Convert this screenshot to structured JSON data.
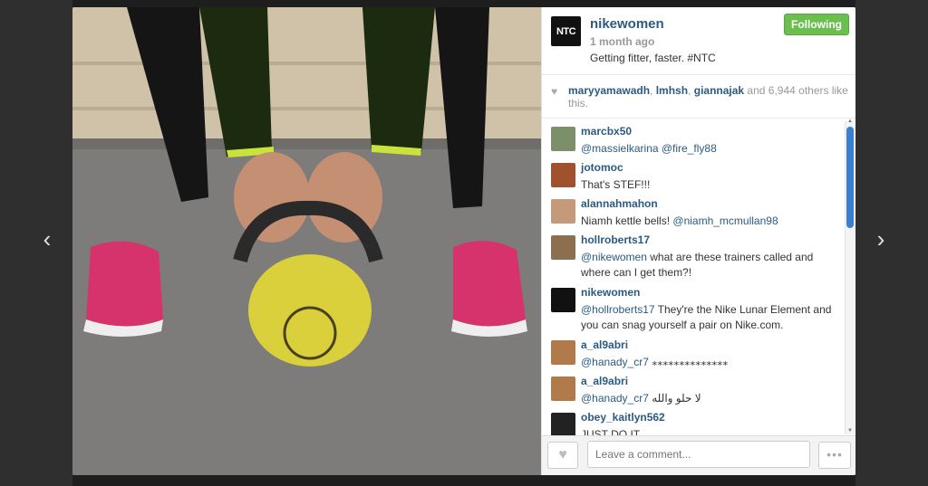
{
  "nav": {
    "prev_icon": "chevron-left-icon",
    "next_icon": "chevron-right-icon",
    "prev_glyph": "‹",
    "next_glyph": "›"
  },
  "post": {
    "avatar_text": "NTC",
    "username": "nikewomen",
    "time": "1 month ago",
    "caption": "Getting fitter, faster. #NTC",
    "follow_label": "Following",
    "likes": {
      "users": [
        "maryyamawadh",
        "lmhsh",
        "giannajak"
      ],
      "sep1": ", ",
      "sep2": ", ",
      "tail": " and 6,944 others like this."
    }
  },
  "comments": [
    {
      "user": "marcbx50",
      "mention": "@massielkarina @fire_fly88",
      "text": "",
      "avatar_color": "#7a8f6a"
    },
    {
      "user": "jotomoc",
      "mention": "",
      "text": "That's STEF!!!",
      "avatar_color": "#a0522d"
    },
    {
      "user": "alannahmahon",
      "mention": "",
      "text": "Niamh kettle bells!",
      "mention_after": "@niamh_mcmullan98",
      "avatar_color": "#c49a7a"
    },
    {
      "user": "hollroberts17",
      "mention": "@nikewomen",
      "text": " what are these trainers called and where can I get them?!",
      "avatar_color": "#8b6f4e"
    },
    {
      "user": "nikewomen",
      "mention": "@hollroberts17",
      "text": " They're the Nike Lunar Element and you can snag yourself a pair on Nike.com.",
      "avatar_color": "#111111"
    },
    {
      "user": "a_al9abri",
      "mention": "@hanady_cr7",
      "text": " ⁎⁎⁎⁎⁎⁎⁎⁎⁎⁎⁎⁎⁎⁎",
      "avatar_color": "#b07a4a"
    },
    {
      "user": "a_al9abri",
      "mention": "@hanady_cr7",
      "text": " لا حلو والله",
      "avatar_color": "#b07a4a"
    },
    {
      "user": "obey_kaitlyn562",
      "mention": "",
      "text": "JUST DO IT",
      "avatar_color": "#222222"
    }
  ],
  "footer": {
    "comment_placeholder": "Leave a comment...",
    "like_icon": "heart-icon",
    "more_label": "•••"
  }
}
